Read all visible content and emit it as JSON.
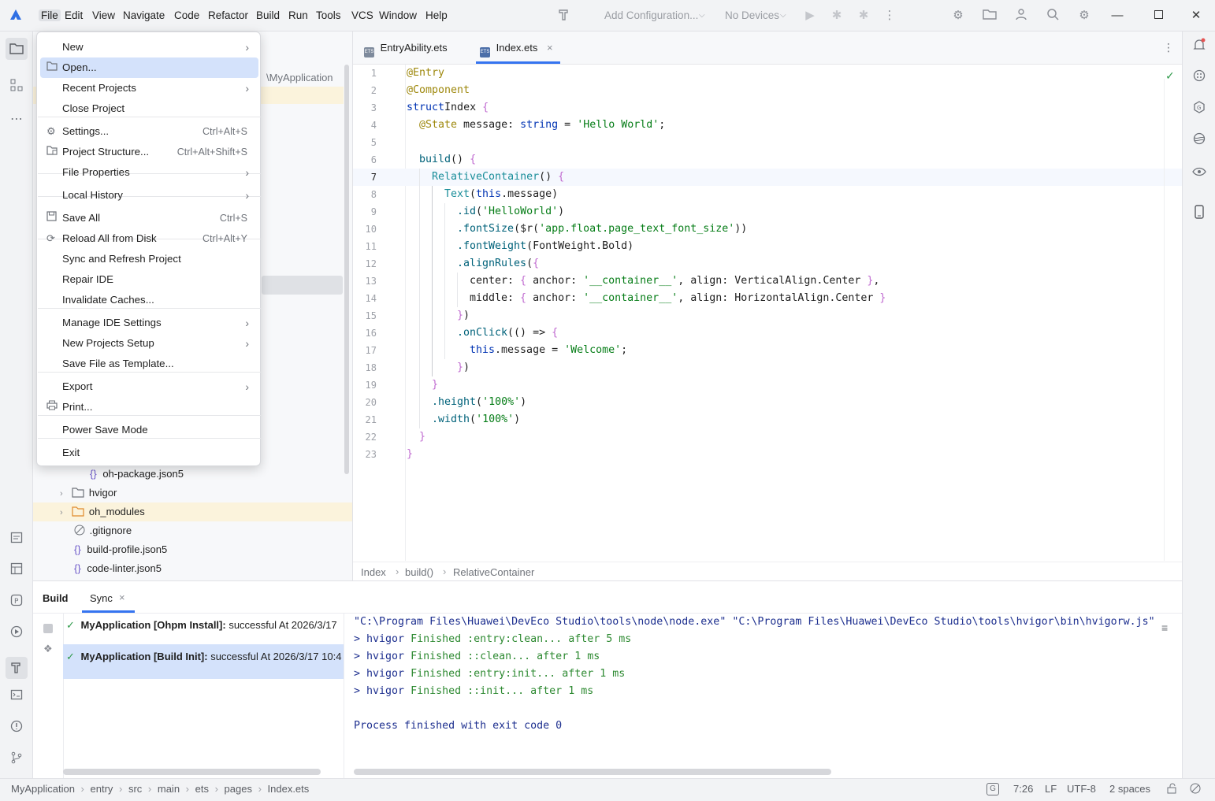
{
  "titlebar": {
    "menus": [
      "File",
      "Edit",
      "View",
      "Navigate",
      "Code",
      "Refactor",
      "Build",
      "Run",
      "Tools",
      "VCS",
      "Window",
      "Help"
    ],
    "run_config": "Add Configuration...",
    "devices": "No Devices",
    "icons": [
      "logo-icon",
      "hammer-icon",
      "run-icon",
      "debug-icon",
      "profile-icon",
      "more-icon",
      "settings-gear-icon",
      "folder-icon",
      "user-icon",
      "search-icon",
      "settings-icon",
      "minimize-icon",
      "maximize-icon",
      "close-icon"
    ]
  },
  "project": {
    "path_fragment": "\\MyApplication",
    "items": [
      {
        "label": "oh-package.json5",
        "type": "json"
      },
      {
        "label": "hvigor",
        "type": "folder"
      },
      {
        "label": "oh_modules",
        "type": "folder-orange"
      },
      {
        "label": ".gitignore",
        "type": "ignore"
      },
      {
        "label": "build-profile.json5",
        "type": "json"
      },
      {
        "label": "code-linter.json5",
        "type": "json"
      }
    ]
  },
  "file_menu": {
    "items": [
      {
        "label": "New",
        "shortcut": "",
        "submenu": true,
        "icon": ""
      },
      {
        "label": "Open...",
        "shortcut": "",
        "submenu": false,
        "icon": "folder-icon",
        "highlighted": true
      },
      {
        "label": "Recent Projects",
        "shortcut": "",
        "submenu": true,
        "icon": ""
      },
      {
        "label": "Close Project",
        "shortcut": "",
        "submenu": false,
        "icon": ""
      },
      {
        "label": "Settings...",
        "shortcut": "Ctrl+Alt+S",
        "submenu": false,
        "icon": "gear-icon"
      },
      {
        "label": "Project Structure...",
        "shortcut": "Ctrl+Alt+Shift+S",
        "submenu": false,
        "icon": "project-structure-icon"
      },
      {
        "label": "File Properties",
        "shortcut": "",
        "submenu": true,
        "icon": ""
      },
      {
        "label": "Local History",
        "shortcut": "",
        "submenu": true,
        "icon": ""
      },
      {
        "label": "Save All",
        "shortcut": "Ctrl+S",
        "submenu": false,
        "icon": "save-icon"
      },
      {
        "label": "Reload All from Disk",
        "shortcut": "Ctrl+Alt+Y",
        "submenu": false,
        "icon": "reload-icon"
      },
      {
        "label": "Sync and Refresh Project",
        "shortcut": "",
        "submenu": false,
        "icon": ""
      },
      {
        "label": "Repair IDE",
        "shortcut": "",
        "submenu": false,
        "icon": ""
      },
      {
        "label": "Invalidate Caches...",
        "shortcut": "",
        "submenu": false,
        "icon": ""
      },
      {
        "label": "Manage IDE Settings",
        "shortcut": "",
        "submenu": true,
        "icon": ""
      },
      {
        "label": "New Projects Setup",
        "shortcut": "",
        "submenu": true,
        "icon": ""
      },
      {
        "label": "Save File as Template...",
        "shortcut": "",
        "submenu": false,
        "icon": ""
      },
      {
        "label": "Export",
        "shortcut": "",
        "submenu": true,
        "icon": ""
      },
      {
        "label": "Print...",
        "shortcut": "",
        "submenu": false,
        "icon": "print-icon"
      },
      {
        "label": "Power Save Mode",
        "shortcut": "",
        "submenu": false,
        "icon": ""
      },
      {
        "label": "Exit",
        "shortcut": "",
        "submenu": false,
        "icon": ""
      }
    ]
  },
  "editor": {
    "tabs": [
      {
        "label": "EntryAbility.ets",
        "active": false
      },
      {
        "label": "Index.ets",
        "active": true
      }
    ],
    "line_numbers": [
      "1",
      "2",
      "3",
      "4",
      "5",
      "6",
      "7",
      "8",
      "9",
      "10",
      "11",
      "12",
      "13",
      "14",
      "15",
      "16",
      "17",
      "18",
      "19",
      "20",
      "21",
      "22",
      "23"
    ],
    "breadcrumb": [
      "Index",
      "build()",
      "RelativeContainer"
    ]
  },
  "build_panel": {
    "tabs": [
      "Build",
      "Sync"
    ],
    "tasks": [
      {
        "name": "MyApplication [Ohpm Install]:",
        "status": "successful At 2026/3/17"
      },
      {
        "name": "MyApplication [Build Init]:",
        "status": "successful At 2026/3/17 10:4"
      }
    ],
    "console": [
      "\"C:\\Program Files\\Huawei\\DevEco Studio\\tools\\node\\node.exe\" \"C:\\Program Files\\Huawei\\DevEco Studio\\tools\\hvigor\\bin\\hvigorw.js\"",
      "> hvigor |Finished :entry:clean... after 5 ms",
      "> hvigor |Finished ::clean... after 1 ms",
      "> hvigor |Finished :entry:init... after 1 ms",
      "> hvigor |Finished ::init... after 1 ms",
      "",
      "Process finished with exit code 0"
    ]
  },
  "statusbar": {
    "breadcrumb": [
      "MyApplication",
      "entry",
      "src",
      "main",
      "ets",
      "pages",
      "Index.ets"
    ],
    "position": "7:26",
    "line_ending": "LF",
    "encoding": "UTF-8",
    "indent": "2 spaces"
  },
  "colors": {
    "highlight": "#d4e2fb",
    "keyword": "#0033b3",
    "string": "#067d17",
    "success": "#2e9a4a"
  }
}
